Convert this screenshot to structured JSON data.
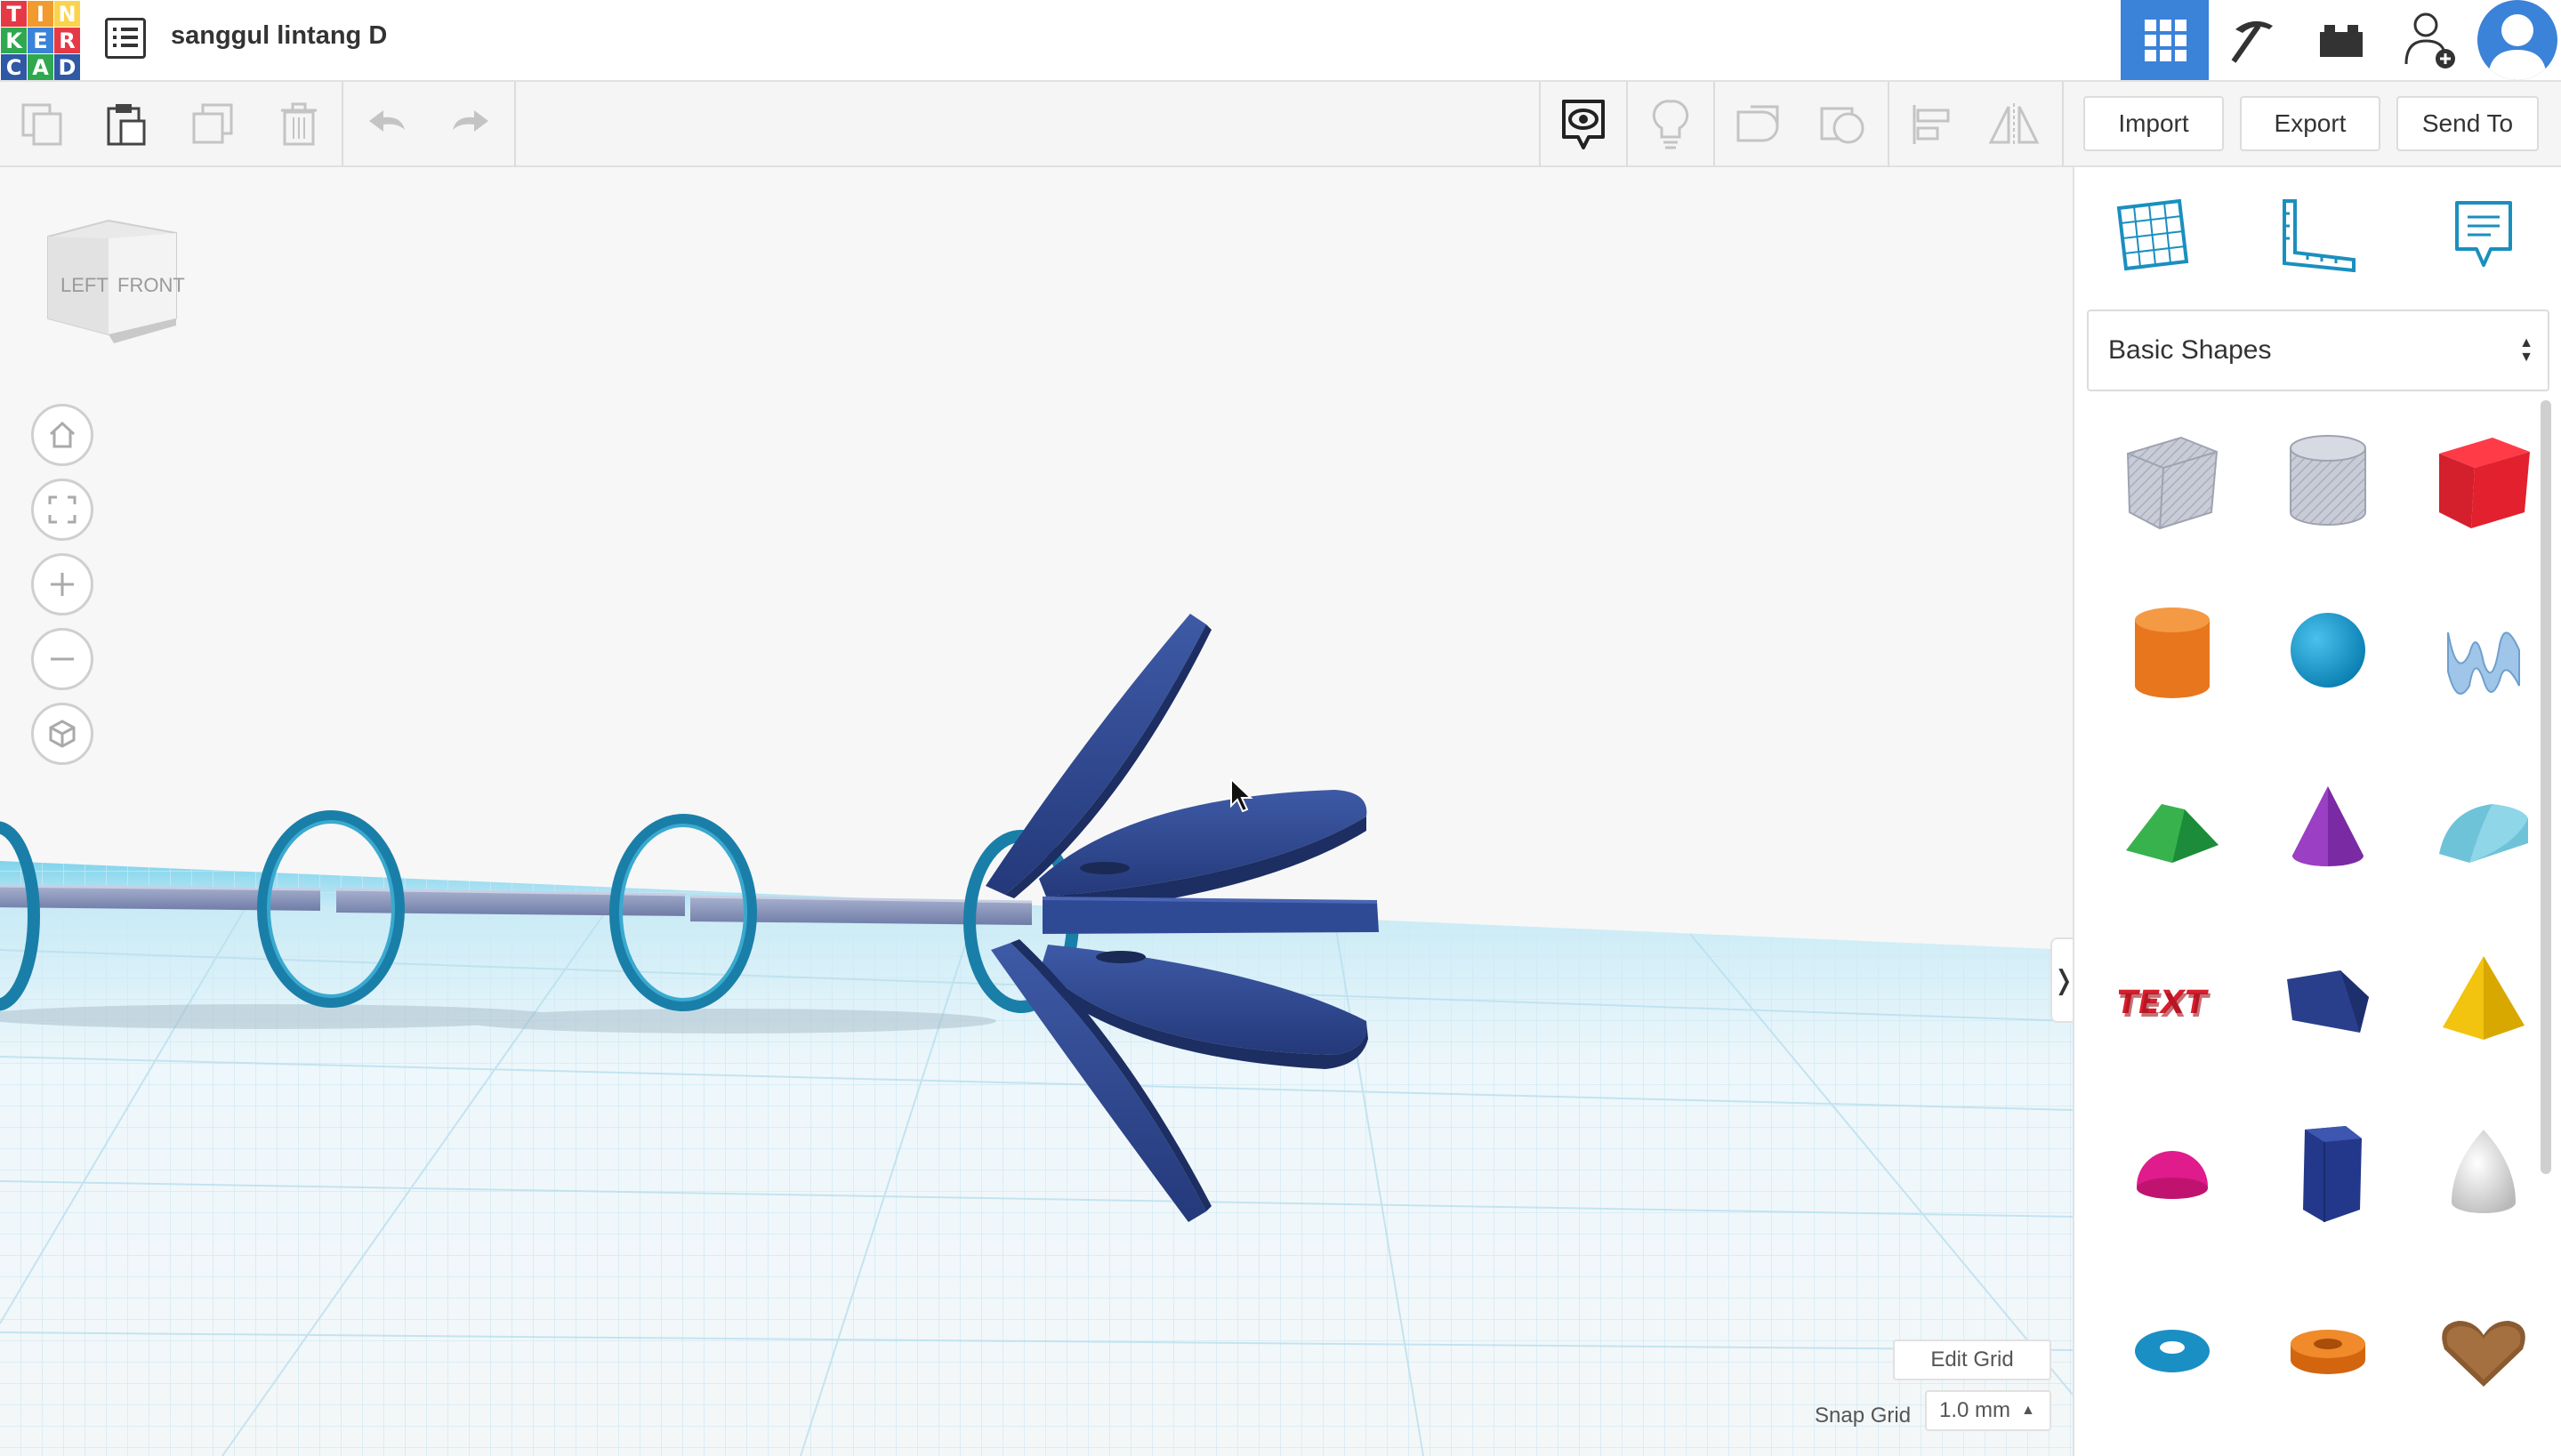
{
  "app": {
    "logo_letters": [
      "T",
      "I",
      "N",
      "K",
      "E",
      "R",
      "C",
      "A",
      "D"
    ],
    "logo_colors": [
      "#e63946",
      "#f19a2d",
      "#fcd34d",
      "#2fa84f",
      "#3b82d9",
      "#e63946",
      "#2f58a5",
      "#2fa84f",
      "#2f58a5"
    ],
    "design_title": "sanggul lintang D"
  },
  "top_right": {
    "items": [
      {
        "name": "3d-design-icon",
        "active": true
      },
      {
        "name": "pickaxe-icon",
        "active": false
      },
      {
        "name": "brick-icon",
        "active": false
      },
      {
        "name": "add-user-icon",
        "active": false
      },
      {
        "name": "user-avatar-icon",
        "active": false
      }
    ],
    "accent": "#3b82d9"
  },
  "toolbar": {
    "left_tools": [
      "copy-icon",
      "paste-icon",
      "duplicate-icon",
      "delete-icon",
      "undo-icon",
      "redo-icon"
    ],
    "right_tools": [
      "show-all-icon",
      "notes-lightbulb-icon",
      "group-icon",
      "ungroup-icon",
      "align-icon",
      "mirror-icon"
    ],
    "import_label": "Import",
    "export_label": "Export",
    "send_to_label": "Send To"
  },
  "viewport": {
    "viewcube": {
      "left": "LEFT",
      "front": "FRONT"
    },
    "nav_buttons": [
      "home-view-icon",
      "fit-view-icon",
      "zoom-in-icon",
      "zoom-out-icon",
      "perspective-icon"
    ],
    "edit_grid_label": "Edit Grid",
    "snap_grid_label": "Snap Grid",
    "snap_grid_value": "1.0 mm",
    "collapse_glyph": "❭"
  },
  "panel": {
    "icons": [
      "workplane-icon",
      "ruler-icon",
      "notes-icon"
    ],
    "category": "Basic Shapes",
    "shapes": [
      "box-hole",
      "cylinder-hole",
      "box",
      "cylinder",
      "sphere",
      "scribble",
      "roof",
      "cone",
      "round-roof",
      "text",
      "wedge",
      "pyramid",
      "half-sphere",
      "polygon",
      "paraboloid",
      "torus",
      "tube",
      "heart"
    ]
  }
}
